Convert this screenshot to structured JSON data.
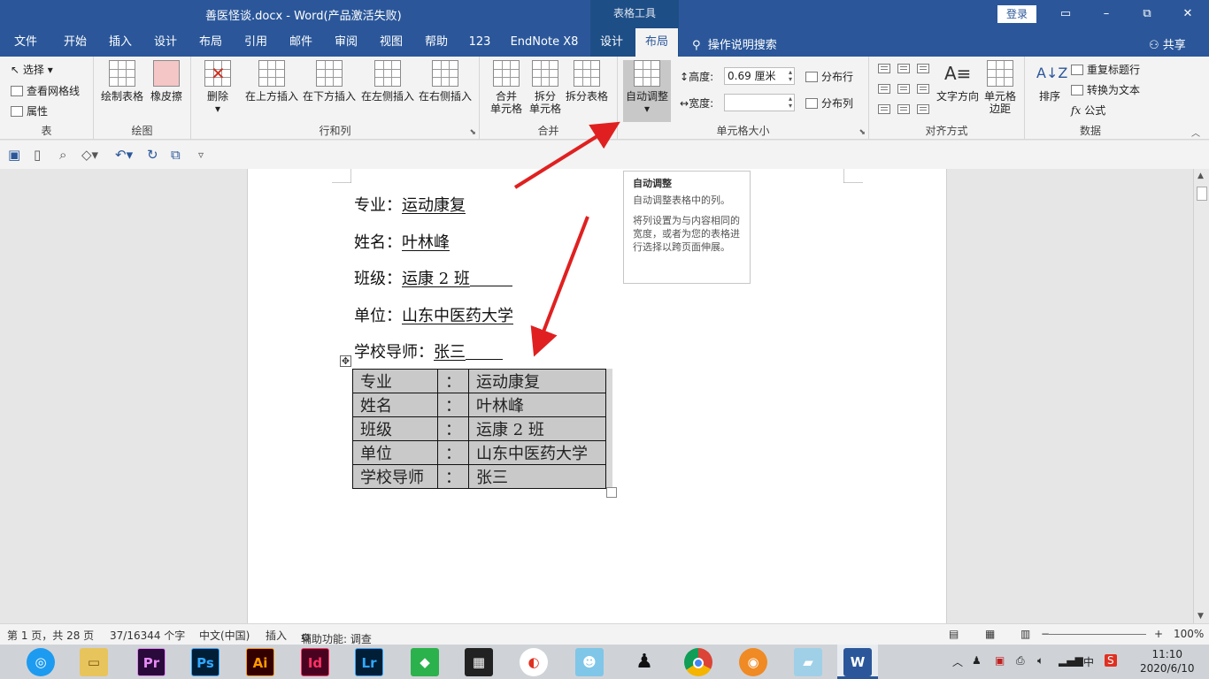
{
  "window": {
    "title": "善医怪谈.docx  -  Word(产品激活失败)",
    "context_tools": "表格工具",
    "login_label": "登录",
    "minimize": "–",
    "restore": "⧉",
    "maximize": "□",
    "close": "✕"
  },
  "tabs": [
    {
      "label": "文件"
    },
    {
      "label": "开始"
    },
    {
      "label": "插入"
    },
    {
      "label": "设计"
    },
    {
      "label": "布局"
    },
    {
      "label": "引用"
    },
    {
      "label": "邮件"
    },
    {
      "label": "审阅"
    },
    {
      "label": "视图"
    },
    {
      "label": "帮助"
    },
    {
      "label": "123"
    },
    {
      "label": "EndNote X8"
    },
    {
      "label": "设计"
    },
    {
      "label": "布局"
    }
  ],
  "tell_me": "操作说明搜索",
  "share": "共享",
  "ribbon": {
    "table_group": {
      "label": "表",
      "select": "选择",
      "view_gridlines": "查看网格线",
      "properties": "属性"
    },
    "draw_group": {
      "label": "绘图",
      "draw_table": "绘制表格",
      "eraser": "橡皮擦"
    },
    "rows_cols_group": {
      "label": "行和列",
      "delete": "删除",
      "insert_above": "在上方插入",
      "insert_below": "在下方插入",
      "insert_left": "在左侧插入",
      "insert_right": "在右侧插入"
    },
    "merge_group": {
      "label": "合并",
      "merge_cells_1": "合并",
      "merge_cells_2": "单元格",
      "split_cells_1": "拆分",
      "split_cells_2": "单元格",
      "split_table": "拆分表格"
    },
    "cell_size_group": {
      "label": "单元格大小",
      "autofit": "自动调整",
      "height_label": "高度:",
      "height_value": "0.69 厘米",
      "width_label": "宽度:",
      "width_value": "",
      "distribute_rows": "分布行",
      "distribute_cols": "分布列"
    },
    "alignment_group": {
      "label": "对齐方式",
      "text_direction": "文字方向",
      "cell_margins_1": "单元格",
      "cell_margins_2": "边距"
    },
    "data_group": {
      "label": "数据",
      "sort": "排序",
      "repeat_header": "重复标题行",
      "convert_to_text": "转换为文本",
      "formula": "公式"
    }
  },
  "tooltip": {
    "title": "自动调整",
    "line1": "自动调整表格中的列。",
    "line2": "将列设置为与内容相同的宽度，或者为您的表格进行选择以跨页面伸展。"
  },
  "document": {
    "lines": [
      {
        "label": "专业：",
        "value": "运动康复"
      },
      {
        "label": "姓名：",
        "value": "叶林峰"
      },
      {
        "label": "班级：",
        "value": "运康 2 班"
      },
      {
        "label": "单位：",
        "value": "山东中医药大学"
      },
      {
        "label": "学校导师：",
        "value": "张三"
      }
    ],
    "table_rows": [
      {
        "c1": "专业",
        "c2": "：",
        "c3": "运动康复"
      },
      {
        "c1": "姓名",
        "c2": "：",
        "c3": "叶林峰"
      },
      {
        "c1": "班级",
        "c2": "：",
        "c3": "运康 2 班"
      },
      {
        "c1": "单位",
        "c2": "：",
        "c3": "山东中医药大学"
      },
      {
        "c1": "学校导师",
        "c2": "：",
        "c3": "张三"
      }
    ]
  },
  "status": {
    "page": "第 1 页，共 28 页",
    "words": "37/16344 个字",
    "language": "中文(中国)",
    "mode": "插入",
    "accessibility": "辅助功能: 调查",
    "zoom": "100%"
  },
  "taskbar": {
    "apps": [
      {
        "label": "Pr",
        "color": "#2a0a3a",
        "fg": "#e58af5"
      },
      {
        "label": "Ps",
        "color": "#001e36",
        "fg": "#31a8ff"
      },
      {
        "label": "Ai",
        "color": "#330000",
        "fg": "#ff9a00"
      },
      {
        "label": "Id",
        "color": "#49021f",
        "fg": "#ff3366"
      },
      {
        "label": "Lr",
        "color": "#001e36",
        "fg": "#31a8ff"
      }
    ],
    "ime": "中",
    "time": "11:10",
    "date": "2020/6/10"
  },
  "colors": {
    "word_blue": "#2b579a",
    "arrow_red": "#e02020"
  }
}
